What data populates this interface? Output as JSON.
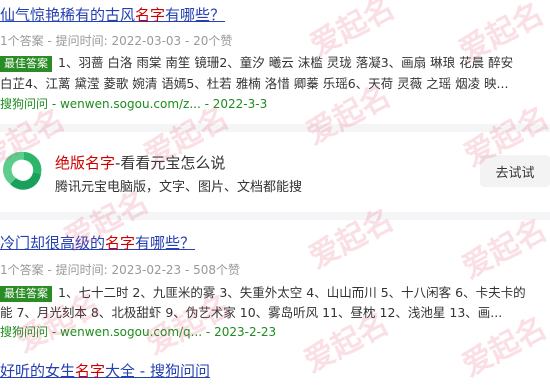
{
  "result1": {
    "title_pre": "仙气惊艳稀有的古风",
    "title_hl": "名字",
    "title_post": "有哪些？",
    "meta": "1个答案 - 提问时间: 2022-03-03 - 20个赞",
    "badge": "最佳答案",
    "line1": "1、羽蔷 白洛 雨棠 南笙 镜珊2、童汐 曦云 沫槛 灵珑 落凝3、画扇 琳琅 花晨 醉安",
    "line2": "白芷4、江蓠 黛滢 菱歌 婉清 语嫣5、杜若 雅楠 洛惜 卿蓁 乐瑶6、天荷 灵薇 之瑶 烟凌 映...",
    "source": "搜狗问问",
    "url": "wenwen.sogou.com/z...",
    "date": "2022-3-3"
  },
  "ad": {
    "title_hl": "绝版名字",
    "title_rest": "-看看元宝怎么说",
    "desc": "腾讯元宝电脑版，文字、图片、文档都能搜",
    "button": "去试试"
  },
  "result2": {
    "title_pre": "冷门却很高级的",
    "title_hl": "名字",
    "title_post": "有哪些？",
    "meta": "1个答案 - 提问时间: 2023-02-23 - 508个赞",
    "badge": "最佳答案",
    "line1": "1、七十二时 2、九匪米的雾 3、失重外太空 4、山山而川 5、十八闲客 6、卡夫卡的",
    "line2": "能 7、月光刻本 8、北极甜虾 9、伪艺术家 10、雾岛听风 11、昼枕 12、浅池星 13、画...",
    "source": "搜狗问问",
    "url": "wenwen.sogou.com/q...",
    "date": "2023-2-23"
  },
  "result3": {
    "title_pre": "好听的女生",
    "title_hl": "名字",
    "title_post": "大全 - 搜狗问问"
  },
  "watermark": "爱起名",
  "colors": {
    "link": "#2440b3",
    "highlight": "#cc0000",
    "badge": "#2a8c25",
    "source": "#1d8c1d",
    "watermark": "rgba(230,80,110,0.18)"
  },
  "icons": {
    "ad_logo": "yuanbao-logo-icon"
  }
}
